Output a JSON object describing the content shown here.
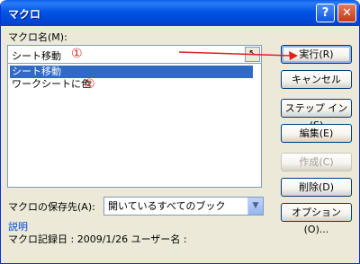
{
  "title": "マクロ",
  "macro_name_label": "マクロ名(M):",
  "macro_name_value": "シート移動",
  "marker_1": "①",
  "marker_2": "②",
  "macros": [
    "シート移動",
    "ワークシートに色"
  ],
  "buttons": {
    "run": "実行(R)",
    "cancel": "キャンセル",
    "step_in": "ステップ イン(S)",
    "edit": "編集(E)",
    "create": "作成(C)",
    "delete": "削除(D)",
    "options": "オプション(O)..."
  },
  "store_label": "マクロの保存先(A):",
  "store_value": "開いているすべてのブック",
  "description_header": "説明",
  "description_text": "マクロ記録日 : 2009/1/26  ユーザー名 :",
  "accent_color": "#e02020",
  "icons": {
    "help": "help-icon",
    "close": "close-icon"
  }
}
